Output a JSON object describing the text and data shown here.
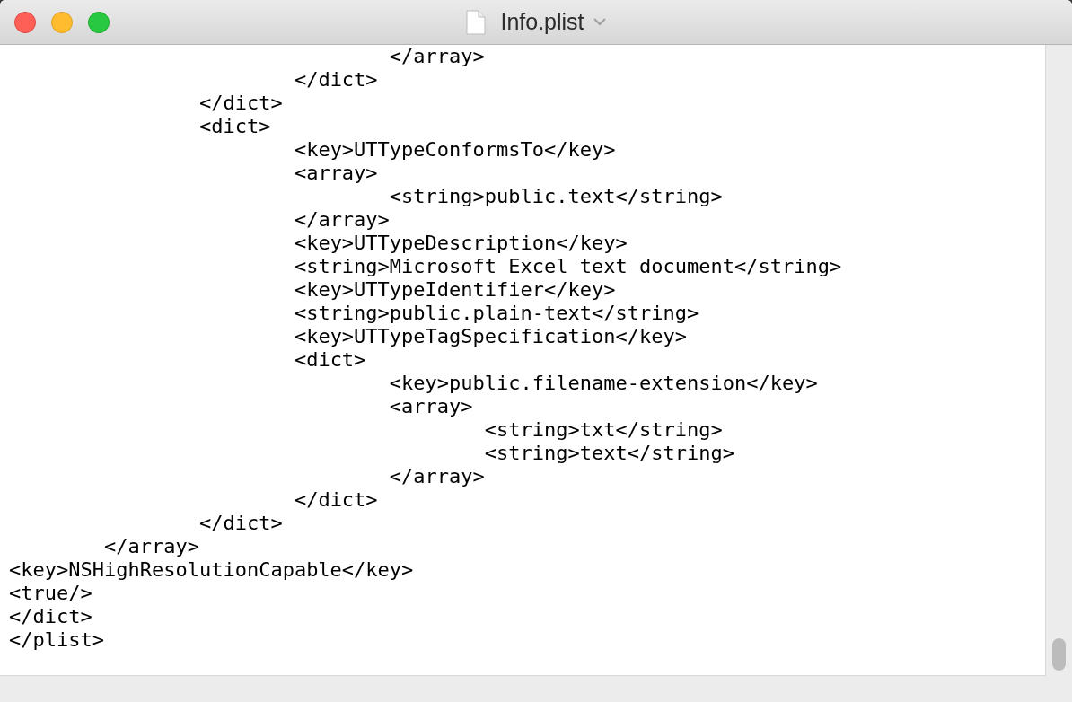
{
  "window": {
    "title": "Info.plist"
  },
  "editor": {
    "lines": [
      "\t\t\t\t</array>",
      "\t\t\t</dict>",
      "\t\t</dict>",
      "\t\t<dict>",
      "\t\t\t<key>UTTypeConformsTo</key>",
      "\t\t\t<array>",
      "\t\t\t\t<string>public.text</string>",
      "\t\t\t</array>",
      "\t\t\t<key>UTTypeDescription</key>",
      "\t\t\t<string>Microsoft Excel text document</string>",
      "\t\t\t<key>UTTypeIdentifier</key>",
      "\t\t\t<string>public.plain-text</string>",
      "\t\t\t<key>UTTypeTagSpecification</key>",
      "\t\t\t<dict>",
      "\t\t\t\t<key>public.filename-extension</key>",
      "\t\t\t\t<array>",
      "\t\t\t\t\t<string>txt</string>",
      "\t\t\t\t\t<string>text</string>",
      "\t\t\t\t</array>",
      "\t\t\t</dict>",
      "\t\t</dict>",
      "\t</array>",
      "<key>NSHighResolutionCapable</key>",
      "<true/>",
      "</dict>",
      "</plist>"
    ]
  }
}
